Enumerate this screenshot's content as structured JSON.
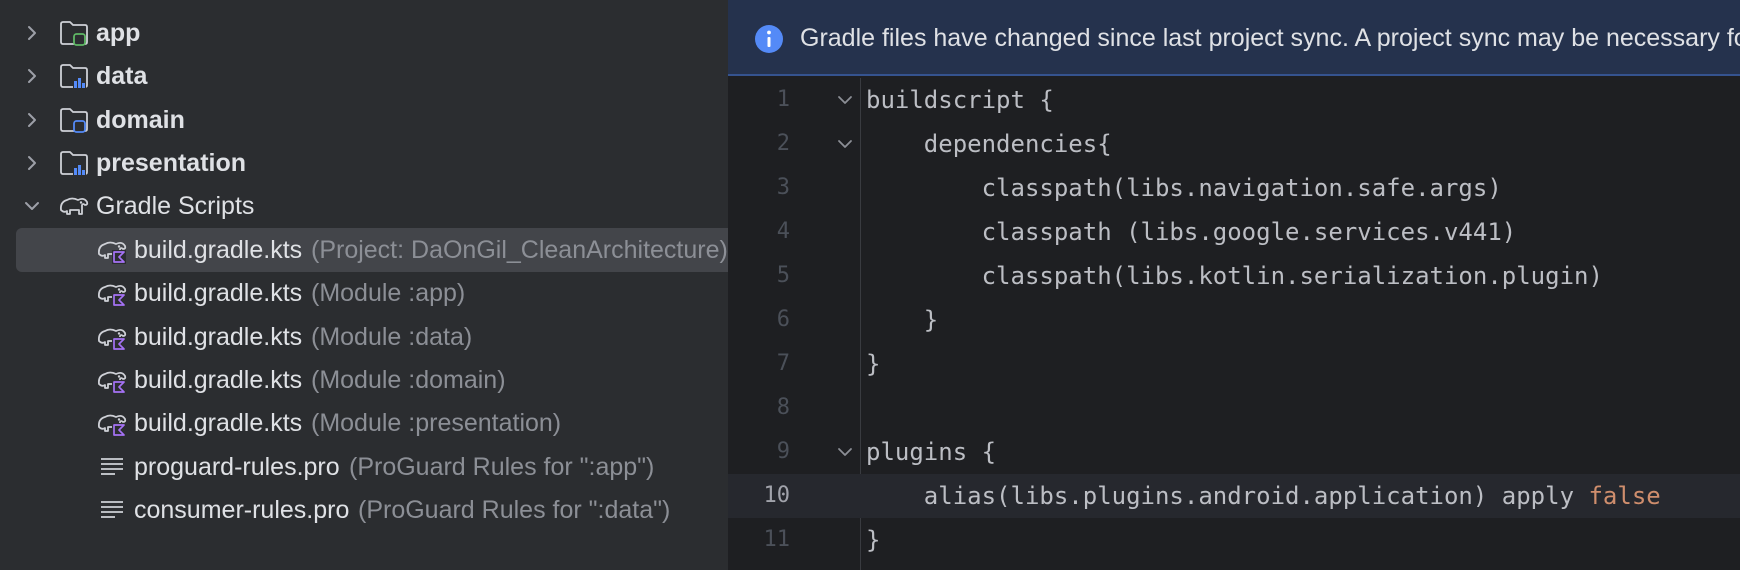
{
  "project_tree": {
    "items": [
      {
        "label": "app",
        "hint": "",
        "type": "module",
        "expanded": false,
        "variant": "app"
      },
      {
        "label": "data",
        "hint": "",
        "type": "module",
        "expanded": false,
        "variant": "lib"
      },
      {
        "label": "domain",
        "hint": "",
        "type": "module",
        "expanded": false,
        "variant": "plain"
      },
      {
        "label": "presentation",
        "hint": "",
        "type": "module",
        "expanded": false,
        "variant": "lib"
      },
      {
        "label": "Gradle Scripts",
        "hint": "",
        "type": "group",
        "expanded": true
      },
      {
        "label": "build.gradle.kts",
        "hint": "(Project: DaOnGil_CleanArchitecture)",
        "type": "gradle",
        "selected": true
      },
      {
        "label": "build.gradle.kts",
        "hint": "(Module :app)",
        "type": "gradle"
      },
      {
        "label": "build.gradle.kts",
        "hint": "(Module :data)",
        "type": "gradle"
      },
      {
        "label": "build.gradle.kts",
        "hint": "(Module :domain)",
        "type": "gradle"
      },
      {
        "label": "build.gradle.kts",
        "hint": "(Module :presentation)",
        "type": "gradle"
      },
      {
        "label": "proguard-rules.pro",
        "hint": "(ProGuard Rules for \":app\")",
        "type": "text"
      },
      {
        "label": "consumer-rules.pro",
        "hint": "(ProGuard Rules for \":data\")",
        "type": "text"
      }
    ]
  },
  "banner": {
    "icon": "info-icon",
    "text": "Gradle files have changed since last project sync. A project sync may be necessary for the IDE to work properly."
  },
  "editor": {
    "current_line": 10,
    "lines": [
      {
        "num": "1",
        "text": "buildscript {",
        "fold": true
      },
      {
        "num": "2",
        "text": "    dependencies{",
        "fold": true
      },
      {
        "num": "3",
        "text": "        classpath(libs.navigation.safe.args)"
      },
      {
        "num": "4",
        "text": "        classpath (libs.google.services.v441)"
      },
      {
        "num": "5",
        "text": "        classpath(libs.kotlin.serialization.plugin)"
      },
      {
        "num": "6",
        "text": "    }"
      },
      {
        "num": "7",
        "text": "}"
      },
      {
        "num": "8",
        "text": ""
      },
      {
        "num": "9",
        "text": "plugins {",
        "fold": true
      },
      {
        "num": "10",
        "text": "    alias(libs.plugins.android.application) apply ",
        "keyword": "false"
      },
      {
        "num": "11",
        "text": "}"
      }
    ]
  },
  "colors": {
    "tree_bg": "#2b2d30",
    "editor_bg": "#1e1f22",
    "banner_bg": "#25324d",
    "selection_bg": "#43454a",
    "keyword_orange": "#cf8e6d",
    "info_blue": "#548af7"
  }
}
